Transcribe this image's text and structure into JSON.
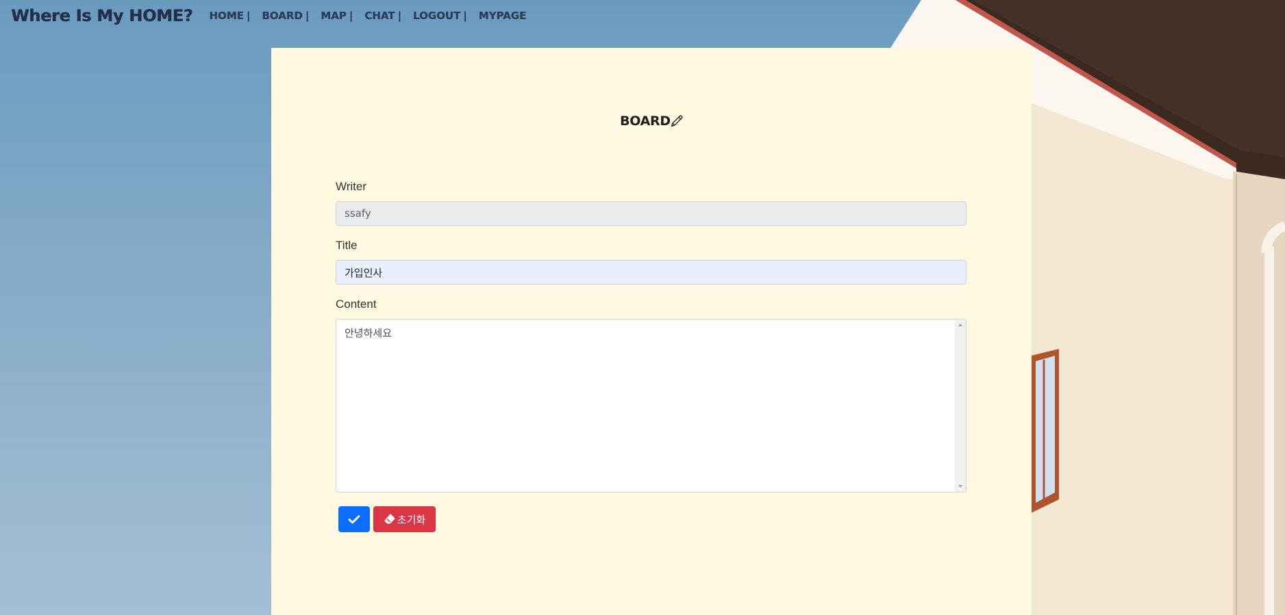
{
  "nav": {
    "brand": "Where Is My HOME?",
    "items": [
      {
        "label": "HOME",
        "sep": "|"
      },
      {
        "label": "BOARD",
        "sep": "|"
      },
      {
        "label": "MAP",
        "sep": "|"
      },
      {
        "label": "CHAT",
        "sep": "|"
      },
      {
        "label": "LOGOUT",
        "sep": "|"
      },
      {
        "label": "MYPAGE",
        "sep": ""
      }
    ]
  },
  "board": {
    "title": "BOARD",
    "title_icon": "pencil-icon",
    "writer_label": "Writer",
    "writer_value": "ssafy",
    "title_label": "Title",
    "title_value": "가입인사",
    "content_label": "Content",
    "content_value": "안녕하세요",
    "submit_icon": "check-icon",
    "reset_icon": "eraser-icon",
    "reset_label": "초기화"
  },
  "colors": {
    "card_background": "#fff9e1",
    "submit_button": "#0d6efd",
    "reset_button": "#dc3545",
    "brand_text": "#22304a"
  }
}
